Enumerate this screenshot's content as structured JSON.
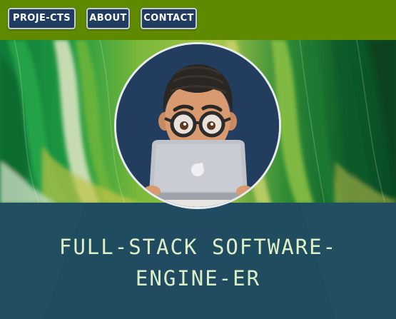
{
  "nav": {
    "projects_label": "PROJE-CTS",
    "about_label": "ABOUT",
    "contact_label": "CONTACT"
  },
  "hero": {
    "headline": "FULL-STACK SOFTWARE-ENGINE-ER",
    "background_image": "green-abstract-paint-brushstrokes",
    "avatar": "memoji-person-with-laptop"
  },
  "colors": {
    "topbar": "#5f8a00",
    "button_bg": "#203d61",
    "button_border": "#c6ccd5",
    "caption_band": "#1e4662",
    "headline_text": "#dcefc7",
    "avatar_bg": "#223d5e"
  }
}
